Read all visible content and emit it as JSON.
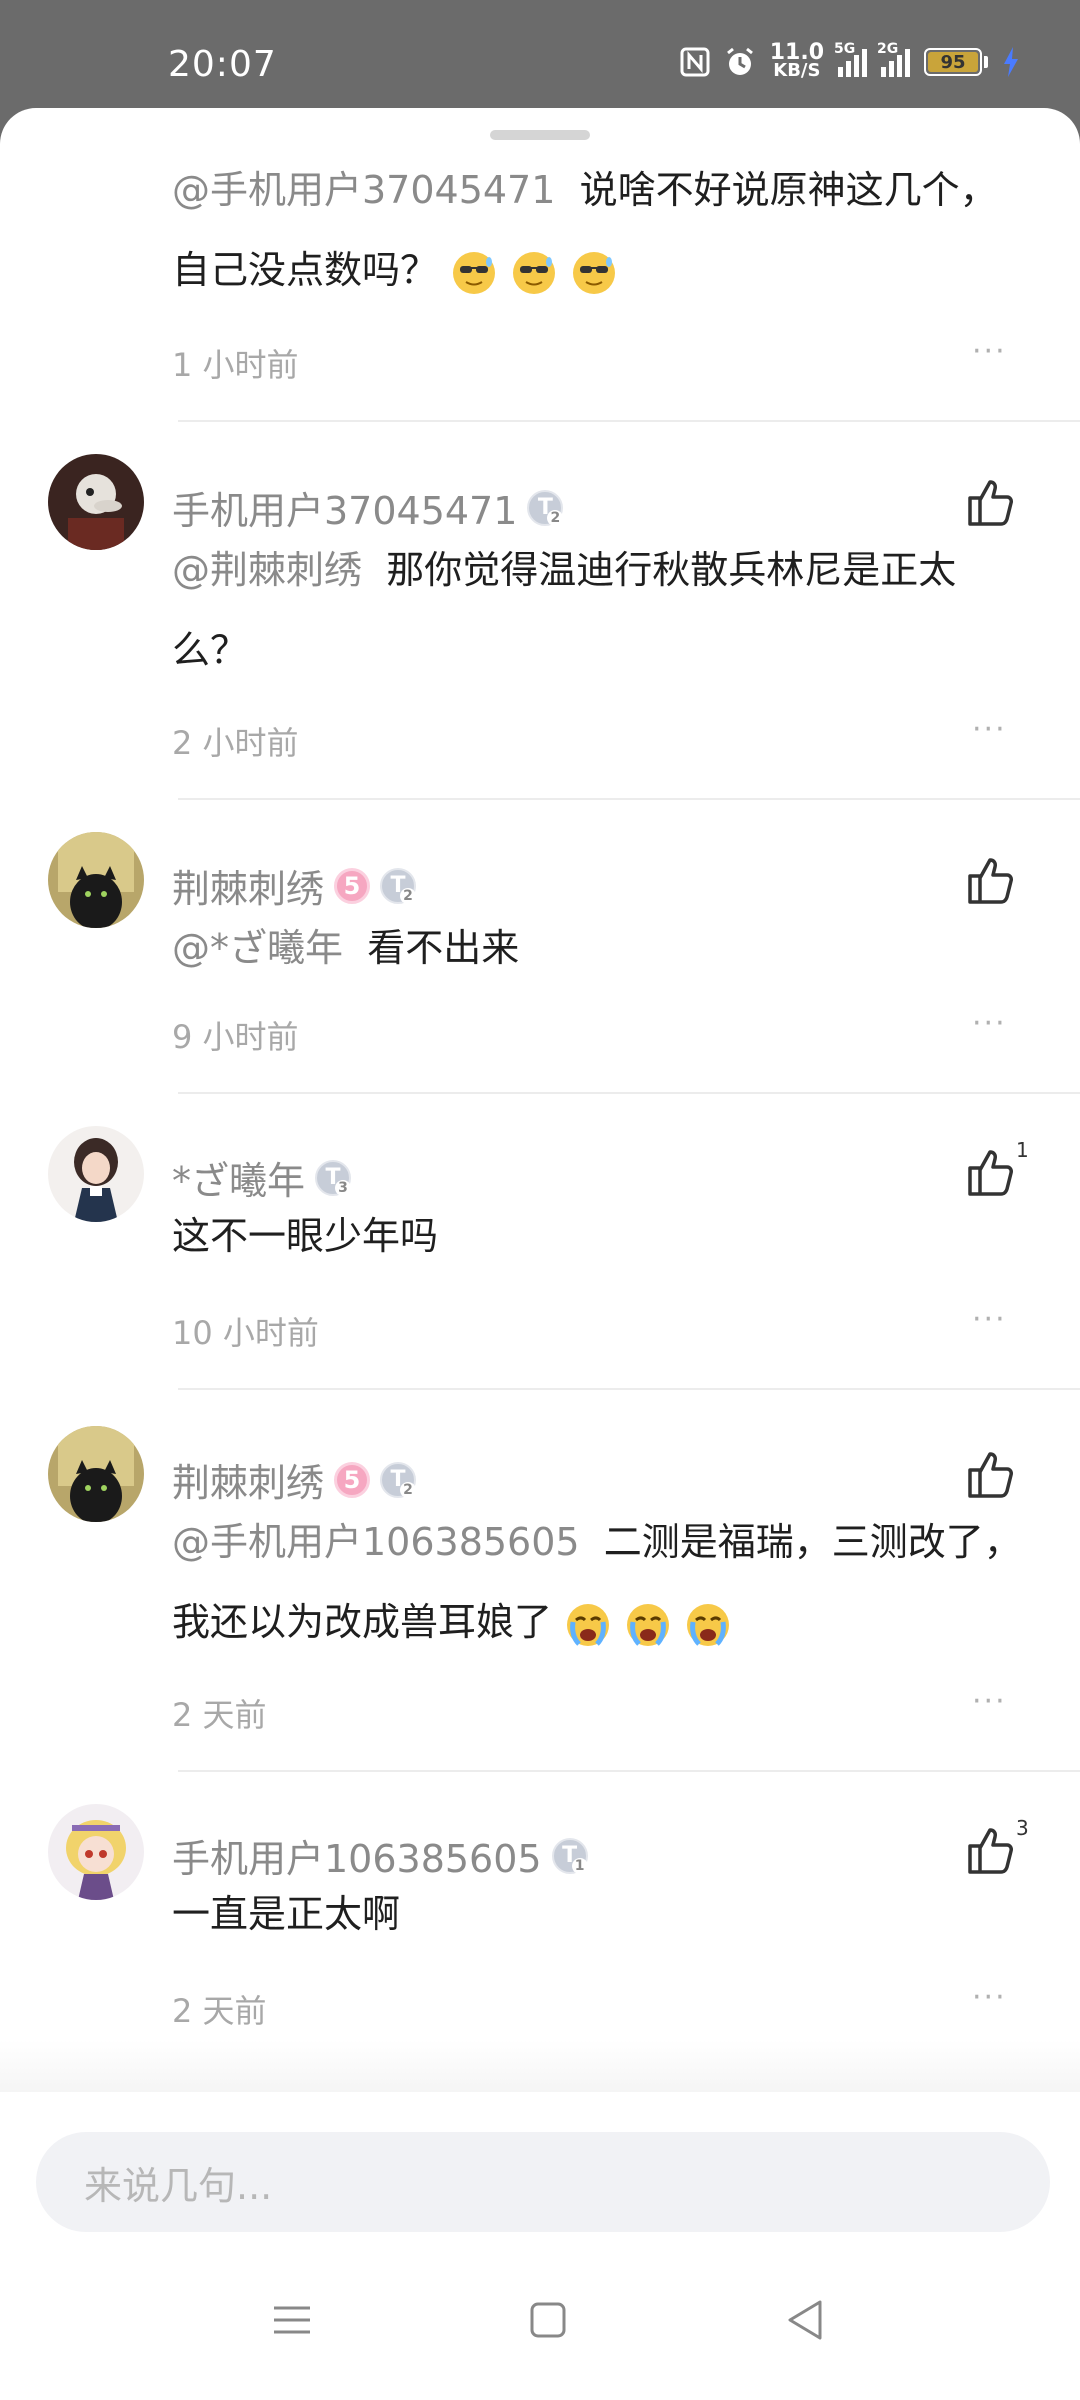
{
  "status_bar": {
    "time": "20:07",
    "net_speed": "11.0",
    "net_unit": "KB/S",
    "sim1": "5G",
    "sim2": "2G",
    "battery": "95"
  },
  "comments": [
    {
      "username": "",
      "mention": "@手机用户37045471",
      "text": "说啥不好说原神这几个，自己没点数吗？",
      "emoji": [
        "sunglasses-sweat-emoji",
        "sunglasses-sweat-emoji",
        "sunglasses-sweat-emoji"
      ],
      "time": "1 小时前",
      "likes": ""
    },
    {
      "username": "手机用户37045471",
      "level_badge": "T2",
      "mention": "@荆棘刺绣",
      "text": "那你觉得温迪行秋散兵林尼是正太么？",
      "time": "2 小时前",
      "likes": ""
    },
    {
      "username": "荆棘刺绣",
      "level_badge": "T2",
      "vip_badge": "5",
      "mention": "@*ざ曦年",
      "text": "看不出来",
      "time": "9 小时前",
      "likes": ""
    },
    {
      "username": "*ざ曦年",
      "level_badge": "T3",
      "mention": "",
      "text": "这不一眼少年吗",
      "time": "10 小时前",
      "likes": "1"
    },
    {
      "username": "荆棘刺绣",
      "level_badge": "T2",
      "vip_badge": "5",
      "mention": "@手机用户106385605",
      "text": "二测是福瑞，三测改了，我还以为改成兽耳娘了",
      "emoji": [
        "crying-emoji",
        "crying-emoji",
        "crying-emoji"
      ],
      "time": "2 天前",
      "likes": ""
    },
    {
      "username": "手机用户106385605",
      "level_badge": "T1",
      "mention": "",
      "text": "一直是正太啊",
      "time": "2 天前",
      "likes": "3"
    }
  ],
  "more_label": "···",
  "input": {
    "placeholder": "来说几句..."
  }
}
